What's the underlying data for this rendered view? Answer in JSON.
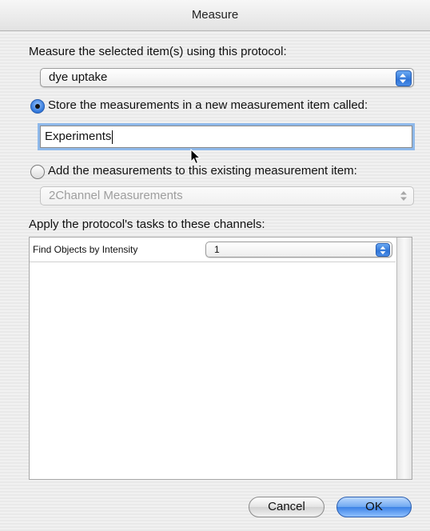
{
  "window": {
    "title": "Measure"
  },
  "protocol": {
    "label": "Measure the selected item(s) using this protocol:",
    "selected": "dye uptake"
  },
  "store_new": {
    "label": "Store the measurements in a new measurement item called:",
    "selected": true,
    "value": "Experiments"
  },
  "add_existing": {
    "label": "Add the measurements to this existing measurement item:",
    "selected": false,
    "value": "2Channel Measurements"
  },
  "channels": {
    "label": "Apply the protocol's tasks to these channels:",
    "rows": [
      {
        "task": "Find Objects by Intensity",
        "channel": "1"
      }
    ]
  },
  "buttons": {
    "cancel": "Cancel",
    "ok": "OK"
  },
  "colors": {
    "accent": "#3c82e6",
    "focus_ring": "#8fb9ea"
  },
  "icons": {
    "popup_arrows": "updown-arrows-icon",
    "cursor": "mouse-pointer-icon"
  }
}
